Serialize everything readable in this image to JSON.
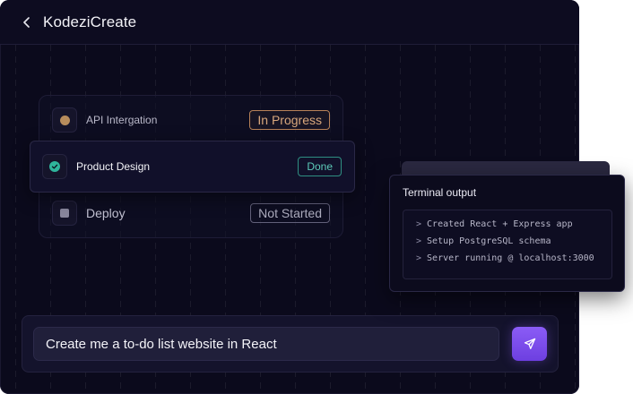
{
  "app": {
    "title": "KodeziCreate"
  },
  "tasks": [
    {
      "label": "API Intergation",
      "status": "In Progress",
      "icon": "dot-icon"
    },
    {
      "label": "Product Design",
      "status": "Done",
      "icon": "check-circle-icon"
    },
    {
      "label": "Deploy",
      "status": "Not Started",
      "icon": "square-icon"
    }
  ],
  "terminal": {
    "title": "Terminal output",
    "lines": [
      "Created React + Express app",
      "Setup PostgreSQL schema",
      "Server running @ localhost:3000"
    ],
    "prefix": ">"
  },
  "composer": {
    "prompt_text": "Create me a to-do list website in React",
    "send_icon": "send-icon"
  },
  "colors": {
    "background": "#0b0a1c",
    "accent": "#8b5cf6",
    "in_progress": "#d8a77c",
    "done": "#5ccab8",
    "not_started": "#aeadbf"
  }
}
